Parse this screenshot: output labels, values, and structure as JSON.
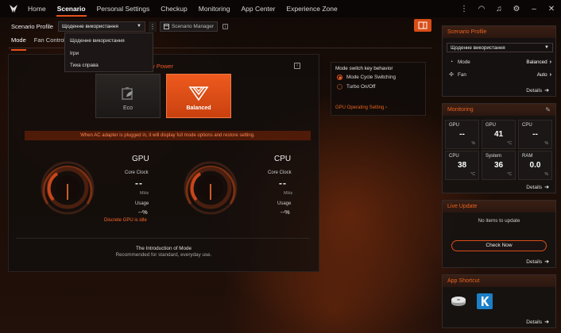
{
  "nav": {
    "tabs": [
      "Home",
      "Scenario",
      "Personal Settings",
      "Checkup",
      "Monitoring",
      "App Center",
      "Experience Zone"
    ],
    "active": "Scenario"
  },
  "top_icons": [
    "menu-dots-icon",
    "headset-icon",
    "bell-icon",
    "gear-icon",
    "minimize-icon",
    "close-icon"
  ],
  "profile": {
    "label": "Scenario Profile",
    "selected": "Щоденне використання",
    "manager_label": "Scenario Manager",
    "dropdown_options": [
      "Щоденне використання",
      "Ігри",
      "Тиха справа"
    ]
  },
  "subtabs": [
    "Mode",
    "Fan Control"
  ],
  "main": {
    "battery_label": "attery Power",
    "modes": [
      {
        "label": "Eco",
        "selected": false
      },
      {
        "label": "Balanced",
        "selected": true
      }
    ],
    "ac_banner": "When AC adapter is plugged in, it will display full mode options and restore setting.",
    "gpu": {
      "title": "GPU",
      "core_clock_label": "Core Clock",
      "core_clock": "--",
      "core_unit": "MHz",
      "usage_label": "Usage",
      "usage": "--%",
      "note": "Discrete GPU is idle"
    },
    "cpu": {
      "title": "CPU",
      "core_clock_label": "Core Clock",
      "core_clock": "--",
      "core_unit": "MHz",
      "usage_label": "Usage",
      "usage": "--%"
    },
    "intro_title": "The Introduction of Mode",
    "intro_sub": "Recommended for standard, everyday use."
  },
  "mode_switch": {
    "title": "Mode switch key behavior",
    "options": [
      {
        "label": "Mode Cycle Switching",
        "selected": true
      },
      {
        "label": "Turbo On/Off",
        "selected": false
      }
    ],
    "gpu_setting": "GPU Operating Setting ›"
  },
  "right": {
    "scenario_card": {
      "title": "Scenario Profile",
      "selected": "Щоденне використання",
      "mode_label": "Mode",
      "mode_value": "Balanced",
      "fan_label": "Fan",
      "fan_value": "Auto",
      "details": "Details"
    },
    "monitoring": {
      "title": "Monitoring",
      "tiles": [
        {
          "label": "GPU",
          "value": "--",
          "unit": "%"
        },
        {
          "label": "GPU",
          "value": "41",
          "unit": "°C"
        },
        {
          "label": "CPU",
          "value": "--",
          "unit": "%"
        },
        {
          "label": "CPU",
          "value": "38",
          "unit": "°C"
        },
        {
          "label": "System",
          "value": "36",
          "unit": "°C"
        },
        {
          "label": "RAM",
          "value": "0.0",
          "unit": "%"
        }
      ],
      "details": "Details"
    },
    "live_update": {
      "title": "Live Update",
      "message": "No items to update",
      "button": "Check Now",
      "details": "Details"
    },
    "app_shortcut": {
      "title": "App Shortcut",
      "apps": [
        "disk-app-icon",
        "k-app-icon"
      ],
      "details": "Details"
    }
  },
  "colors": {
    "accent": "#e8521c",
    "accent_text": "#e8621f"
  }
}
